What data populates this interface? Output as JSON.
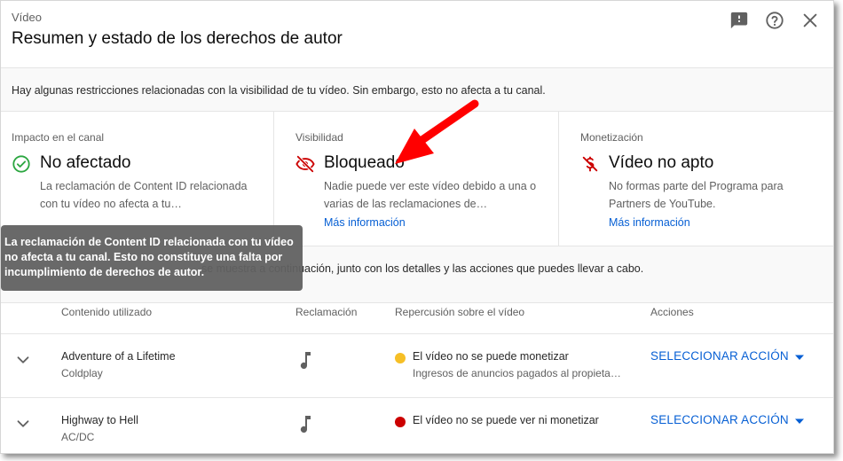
{
  "header": {
    "context": "Vídeo",
    "title": "Resumen y estado de los derechos de autor",
    "icons": [
      "feedback-icon",
      "help-icon",
      "close-icon"
    ]
  },
  "infobar": {
    "text": "Hay algunas restricciones relacionadas con la visibilidad de tu vídeo. Sin embargo, esto no afecta a tu canal."
  },
  "status": [
    {
      "label": "Impacto en el canal",
      "icon": "check-circle-icon",
      "value": "No afectado",
      "desc": "La reclamación de Content ID relacionada con tu vídeo no afecta a tu…",
      "more": ""
    },
    {
      "label": "Visibilidad",
      "icon": "eye-off-icon",
      "value": "Bloqueado",
      "desc": "Nadie puede ver este vídeo debido a una o varias de las reclamaciones de…",
      "more": "Más información"
    },
    {
      "label": "Monetización",
      "icon": "no-money-icon",
      "value": "Vídeo no apto",
      "desc": "No formas parte del Programa para Partners de YouTube.",
      "more": "Más información"
    }
  ],
  "claims_intro": {
    "visible_text": "se muestra a continuación, junto con los detalles y las acciones que puedes llevar a cabo."
  },
  "table": {
    "headers": [
      "Contenido utilizado",
      "Reclamación",
      "Repercusión sobre el vídeo",
      "Acciones"
    ],
    "rows": [
      {
        "title": "Adventure of a Lifetime",
        "artist": "Coldplay",
        "claim_icon": "music-note-icon",
        "impact": "El vídeo no se puede monetizar",
        "impact_sub": "Ingresos de anuncios pagados al propieta…",
        "status_color": "#f6bf26",
        "action": "SELECCIONAR ACCIÓN"
      },
      {
        "title": "Highway to Hell",
        "artist": "AC/DC",
        "claim_icon": "music-note-icon",
        "impact": "El vídeo no se puede ver ni monetizar",
        "impact_sub": "",
        "status_color": "#cc0000",
        "action": "SELECCIONAR ACCIÓN"
      }
    ]
  },
  "tooltip": {
    "text": "La reclamación de Content ID relacionada con tu vídeo no afecta a tu canal. Esto no constituye una falta por incumplimiento de derechos de autor."
  },
  "colors": {
    "link": "#065fd4",
    "success": "#2ba640",
    "error": "#cc0000",
    "annotation": "#ff0000"
  }
}
